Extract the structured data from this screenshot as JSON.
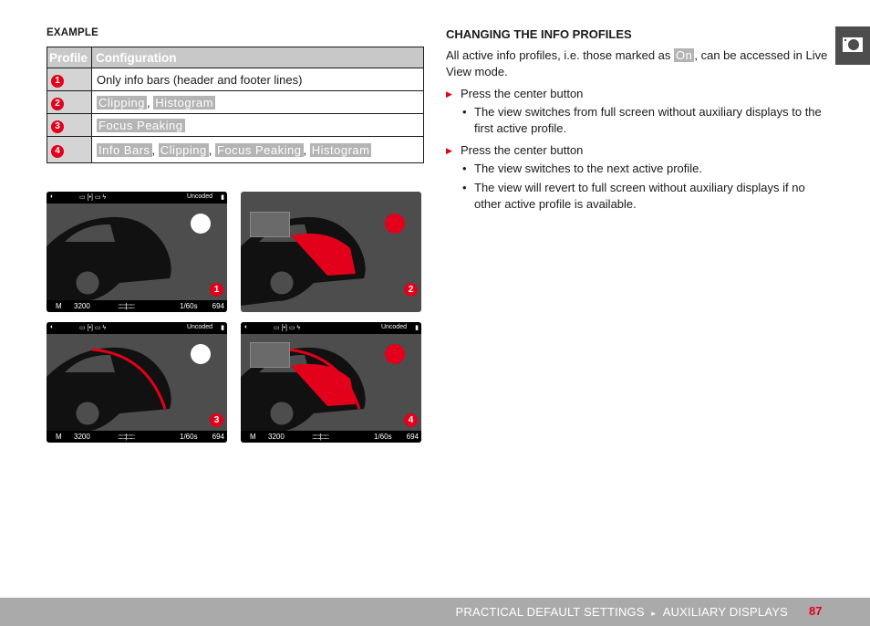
{
  "left": {
    "example_title": "EXAMPLE",
    "table": {
      "headers": [
        "Profile",
        "Configuration"
      ],
      "rows": [
        {
          "profile": "1",
          "configuration_text": "Only info bars (header and footer lines)",
          "tags": []
        },
        {
          "profile": "2",
          "configuration_text": "",
          "tags": [
            "Clipping",
            "Histogram"
          ]
        },
        {
          "profile": "3",
          "configuration_text": "",
          "tags": [
            "Focus Peaking"
          ]
        },
        {
          "profile": "4",
          "configuration_text": "",
          "tags": [
            "Info Bars",
            "Clipping",
            "Focus Peaking",
            "Histogram"
          ]
        }
      ]
    },
    "screens": [
      {
        "number": "1",
        "info_bars": true,
        "histogram": false,
        "clipping": false,
        "focus_peaking": false
      },
      {
        "number": "2",
        "info_bars": false,
        "histogram": true,
        "clipping": true,
        "focus_peaking": false
      },
      {
        "number": "3",
        "info_bars": true,
        "histogram": false,
        "clipping": false,
        "focus_peaking": true
      },
      {
        "number": "4",
        "info_bars": true,
        "histogram": true,
        "clipping": true,
        "focus_peaking": true
      }
    ],
    "screen_bar": {
      "top_right": "Uncoded",
      "bottom": {
        "mode": "M",
        "iso": "3200",
        "shutter": "1/60s",
        "shots": "694"
      }
    }
  },
  "right": {
    "section_title": "CHANGING THE INFO PROFILES",
    "intro_before": "All active info profiles, i.e. those marked as ",
    "intro_tag": "On",
    "intro_after": ", can be accessed in Live View mode.",
    "steps": [
      {
        "action": "Press the center button",
        "results": [
          "The view switches from full screen without auxiliary displays to the first active profile."
        ]
      },
      {
        "action": "Press the center button",
        "results": [
          "The view switches to the next active profile.",
          "The view will revert to full screen without auxiliary displays if no other active profile is available."
        ]
      }
    ]
  },
  "side_tab": {
    "icon": "camera-icon"
  },
  "footer": {
    "breadcrumb_1": "PRACTICAL DEFAULT SETTINGS",
    "breadcrumb_sep": "▸",
    "breadcrumb_2": "AUXILIARY DISPLAYS",
    "page_number": "87"
  },
  "colors": {
    "accent": "#e2001a",
    "tag_bg": "#b4b4b4",
    "screen_bg": "#4d4d4d",
    "footer_bg": "#aaaaaa"
  }
}
